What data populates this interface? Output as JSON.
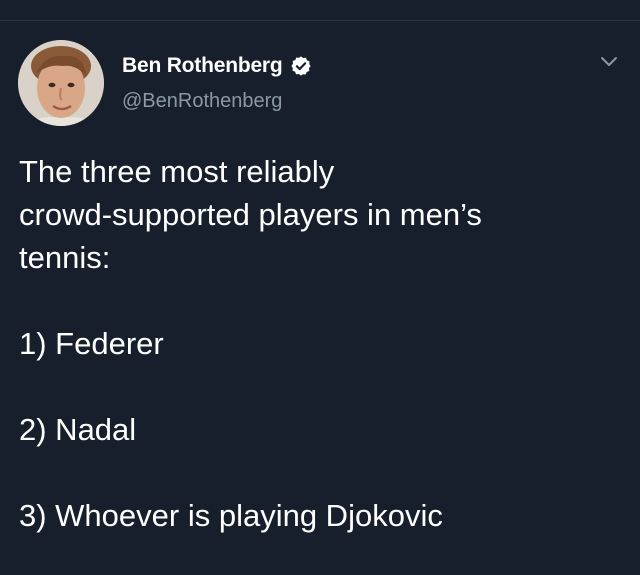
{
  "header": {
    "display_name": "Ben Rothenberg",
    "handle": "@BenRothenberg",
    "verified": true
  },
  "tweet": {
    "intro_lines": [
      "The three most reliably",
      "crowd-supported players in men’s",
      "tennis:"
    ],
    "list": [
      "1) Federer",
      "2) Nadal",
      "3) Whoever is playing Djokovic"
    ]
  },
  "colors": {
    "background": "#161f2b",
    "text": "#ffffff",
    "secondary_text": "#8b98a5",
    "divider": "#2a3544"
  },
  "icons": {
    "verified": "verified-badge-icon",
    "menu": "chevron-down-icon"
  }
}
